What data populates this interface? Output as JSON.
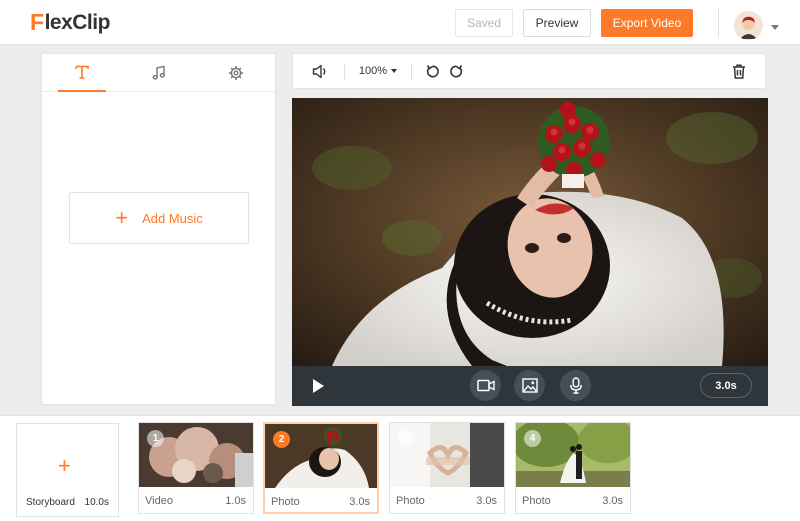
{
  "app": {
    "logo_text": "lexClip",
    "logo_mark": "F"
  },
  "header": {
    "saved_label": "Saved",
    "preview_label": "Preview",
    "export_label": "Export Video"
  },
  "left_panel": {
    "tabs": [
      {
        "name": "text",
        "icon": "text-icon"
      },
      {
        "name": "music",
        "icon": "music-note-icon"
      },
      {
        "name": "settings",
        "icon": "gear-icon"
      }
    ],
    "active_tab": "text",
    "add_music_label": "Add Music",
    "add_music_icon": "plus"
  },
  "toolbar": {
    "zoom": "100%",
    "icons": [
      "volume-icon",
      "undo-icon",
      "redo-icon",
      "trash-icon"
    ]
  },
  "stage": {
    "duration": "3.0s",
    "controls": [
      "play-icon",
      "video-camera-icon",
      "image-icon",
      "microphone-icon"
    ]
  },
  "storyboard": {
    "label": "Storyboard",
    "total": "10.0s",
    "clips": [
      {
        "num": "1",
        "type": "Video",
        "duration": "1.0s",
        "selected": false
      },
      {
        "num": "2",
        "type": "Photo",
        "duration": "3.0s",
        "selected": true
      },
      {
        "num": "3",
        "type": "Photo",
        "duration": "3.0s",
        "selected": false
      },
      {
        "num": "4",
        "type": "Photo",
        "duration": "3.0s",
        "selected": false
      }
    ]
  },
  "colors": {
    "accent": "#ff7a26",
    "stage_controls": "#2e353b",
    "background": "#ececec"
  }
}
